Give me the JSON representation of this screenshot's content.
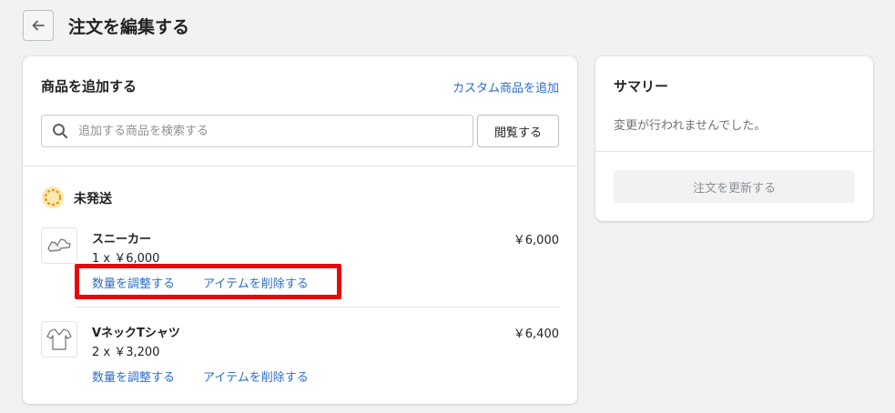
{
  "header": {
    "title": "注文を編集する",
    "back_icon": "arrow-left-icon"
  },
  "add_products": {
    "title": "商品を追加する",
    "custom_link": "カスタム商品を追加",
    "search_placeholder": "追加する商品を検索する",
    "search_value": "",
    "browse_label": "閲覧する"
  },
  "unfulfilled": {
    "status_label": "未発送",
    "status_color": "#ffc453",
    "items": [
      {
        "name": "スニーカー",
        "quantity_price": "1 x ￥6,000",
        "total": "￥6,000",
        "adjust_label": "数量を調整する",
        "remove_label": "アイテムを削除する",
        "thumbnail_icon": "sneaker-icon"
      },
      {
        "name": "VネックTシャツ",
        "quantity_price": "2 x ￥3,200",
        "total": "￥6,400",
        "adjust_label": "数量を調整する",
        "remove_label": "アイテムを削除する",
        "thumbnail_icon": "tshirt-icon"
      }
    ]
  },
  "summary": {
    "title": "サマリー",
    "message": "変更が行われませんでした。",
    "update_label": "注文を更新する"
  },
  "colors": {
    "link": "#2c6ecb",
    "highlight": "#e50a0a",
    "background": "#f1f2f3"
  }
}
